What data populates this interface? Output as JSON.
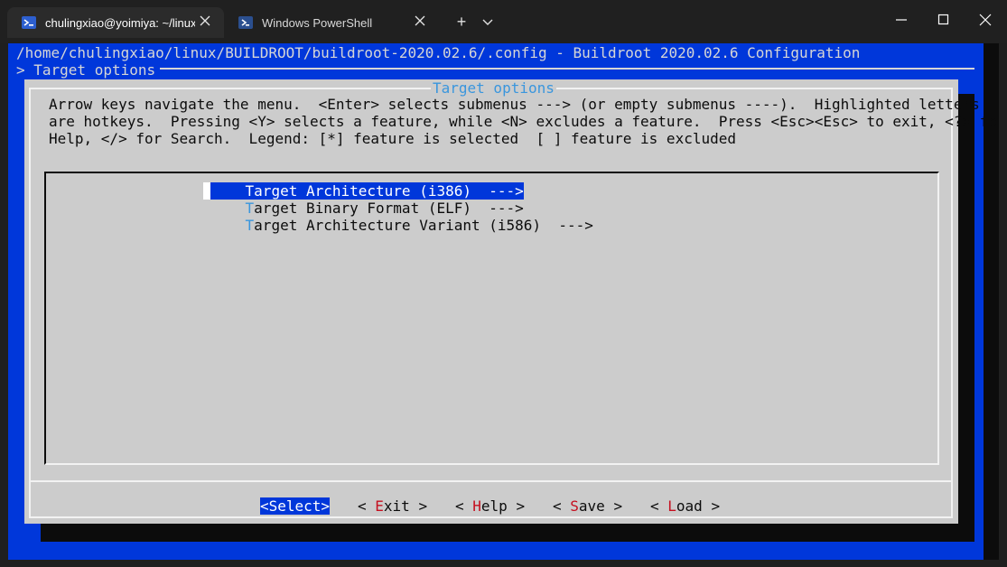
{
  "tabs": [
    {
      "label": "chulingxiao@yoimiya: ~/linux",
      "icon": "terminal-icon",
      "active": true
    },
    {
      "label": "Windows PowerShell",
      "icon": "powershell-icon",
      "active": false
    }
  ],
  "new_tab_label": "+",
  "terminal": {
    "path_line": "/home/chulingxiao/linux/BUILDROOT/buildroot-2020.02.6/.config - Buildroot 2020.02.6 Configuration",
    "breadcrumb": "> Target options"
  },
  "dialog": {
    "title": "Target options",
    "help_lines": [
      "Arrow keys navigate the menu.  <Enter> selects submenus ---> (or empty submenus ----).  Highlighted letters",
      "are hotkeys.  Pressing <Y> selects a feature, while <N> excludes a feature.  Press <Esc><Esc> to exit, <?> for",
      "Help, </> for Search.  Legend: [*] feature is selected  [ ] feature is excluded"
    ],
    "menu_items": [
      {
        "hotkey": "T",
        "rest": "arget Architecture (i386)  --->",
        "selected": true
      },
      {
        "hotkey": "T",
        "rest": "arget Binary Format (ELF)  --->",
        "selected": false
      },
      {
        "hotkey": "T",
        "rest": "arget Architecture Variant (i586)  --->",
        "selected": false
      }
    ],
    "buttons": [
      {
        "full": "<Select>",
        "selected": true
      },
      {
        "pre": "< ",
        "hotkey": "E",
        "rest": "xit >"
      },
      {
        "pre": "< ",
        "hotkey": "H",
        "rest": "elp >"
      },
      {
        "pre": "< ",
        "hotkey": "S",
        "rest": "ave >"
      },
      {
        "pre": "< ",
        "hotkey": "L",
        "rest": "oad >"
      }
    ]
  },
  "colors": {
    "blue_bg": "#0037da",
    "dialog_bg": "#cccccc",
    "title_cyan": "#3a96dd",
    "hotkey_red": "#c50f1f"
  }
}
